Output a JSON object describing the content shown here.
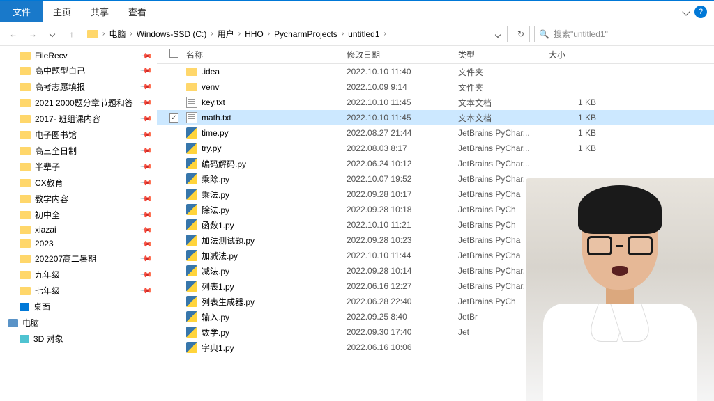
{
  "ribbon": {
    "file": "文件",
    "tabs": [
      "主页",
      "共享",
      "查看"
    ]
  },
  "breadcrumb": [
    "电脑",
    "Windows-SSD (C:)",
    "用户",
    "HHO",
    "PycharmProjects",
    "untitled1"
  ],
  "search": {
    "placeholder": "搜索\"untitled1\""
  },
  "columns": {
    "name": "名称",
    "date": "修改日期",
    "type": "类型",
    "size": "大小"
  },
  "sidebar": [
    {
      "kind": "folder",
      "label": "FileRecv",
      "pinned": true
    },
    {
      "kind": "folder",
      "label": "高中题型自己",
      "pinned": true
    },
    {
      "kind": "folder",
      "label": "高考志愿填报",
      "pinned": true
    },
    {
      "kind": "folder",
      "label": "2021 2000题分章节题和答",
      "pinned": true
    },
    {
      "kind": "folder",
      "label": "2017- 班组课内容",
      "pinned": true
    },
    {
      "kind": "folder",
      "label": "电子图书馆",
      "pinned": true
    },
    {
      "kind": "folder",
      "label": "高三全日制",
      "pinned": true
    },
    {
      "kind": "folder",
      "label": "半辈子",
      "pinned": true
    },
    {
      "kind": "folder",
      "label": "CX教育",
      "pinned": true
    },
    {
      "kind": "folder",
      "label": "教学内容",
      "pinned": true
    },
    {
      "kind": "folder",
      "label": "初中全",
      "pinned": true
    },
    {
      "kind": "folder",
      "label": "xiazai",
      "pinned": true
    },
    {
      "kind": "folder",
      "label": "2023",
      "pinned": true
    },
    {
      "kind": "folder",
      "label": "202207高二暑期",
      "pinned": true
    },
    {
      "kind": "folder",
      "label": "九年级",
      "pinned": true
    },
    {
      "kind": "folder",
      "label": "七年级",
      "pinned": true
    },
    {
      "kind": "desktop",
      "label": "桌面",
      "pinned": false
    },
    {
      "kind": "pc",
      "label": "电脑",
      "pinned": false,
      "lvl": 1
    },
    {
      "kind": "obj3d",
      "label": "3D 对象",
      "pinned": false
    }
  ],
  "files": [
    {
      "icon": "folder",
      "name": ".idea",
      "date": "2022.10.10 11:40",
      "type": "文件夹",
      "size": "",
      "selected": false
    },
    {
      "icon": "folder",
      "name": "venv",
      "date": "2022.10.09 9:14",
      "type": "文件夹",
      "size": "",
      "selected": false
    },
    {
      "icon": "txt",
      "name": "key.txt",
      "date": "2022.10.10 11:45",
      "type": "文本文档",
      "size": "1 KB",
      "selected": false
    },
    {
      "icon": "txt",
      "name": "math.txt",
      "date": "2022.10.10 11:45",
      "type": "文本文档",
      "size": "1 KB",
      "selected": true
    },
    {
      "icon": "py",
      "name": "time.py",
      "date": "2022.08.27 21:44",
      "type": "JetBrains PyChar...",
      "size": "1 KB",
      "selected": false
    },
    {
      "icon": "py",
      "name": "try.py",
      "date": "2022.08.03 8:17",
      "type": "JetBrains PyChar...",
      "size": "1 KB",
      "selected": false
    },
    {
      "icon": "py",
      "name": "编码解码.py",
      "date": "2022.06.24 10:12",
      "type": "JetBrains PyChar...",
      "size": "",
      "selected": false
    },
    {
      "icon": "py",
      "name": "乘除.py",
      "date": "2022.10.07 19:52",
      "type": "JetBrains PyChar.",
      "size": "",
      "selected": false
    },
    {
      "icon": "py",
      "name": "乘法.py",
      "date": "2022.09.28 10:17",
      "type": "JetBrains PyCha",
      "size": "",
      "selected": false
    },
    {
      "icon": "py",
      "name": "除法.py",
      "date": "2022.09.28 10:18",
      "type": "JetBrains PyCh",
      "size": "",
      "selected": false
    },
    {
      "icon": "py",
      "name": "函数1.py",
      "date": "2022.10.10 11:21",
      "type": "JetBrains PyCh",
      "size": "",
      "selected": false
    },
    {
      "icon": "py",
      "name": "加法测试题.py",
      "date": "2022.09.28 10:23",
      "type": "JetBrains PyCha",
      "size": "",
      "selected": false
    },
    {
      "icon": "py",
      "name": "加减法.py",
      "date": "2022.10.10 11:44",
      "type": "JetBrains PyCha",
      "size": "",
      "selected": false
    },
    {
      "icon": "py",
      "name": "减法.py",
      "date": "2022.09.28 10:14",
      "type": "JetBrains PyChar.",
      "size": "",
      "selected": false
    },
    {
      "icon": "py",
      "name": "列表1.py",
      "date": "2022.06.16 12:27",
      "type": "JetBrains PyChar...",
      "size": "",
      "selected": false
    },
    {
      "icon": "py",
      "name": "列表生成器.py",
      "date": "2022.06.28 22:40",
      "type": "JetBrains PyCh",
      "size": "",
      "selected": false
    },
    {
      "icon": "py",
      "name": "输入.py",
      "date": "2022.09.25 8:40",
      "type": "JetBr",
      "size": "",
      "selected": false
    },
    {
      "icon": "py",
      "name": "数学.py",
      "date": "2022.09.30 17:40",
      "type": "Jet",
      "size": "",
      "selected": false
    },
    {
      "icon": "py",
      "name": "字典1.py",
      "date": "2022.06.16 10:06",
      "type": "",
      "size": "",
      "selected": false
    }
  ]
}
